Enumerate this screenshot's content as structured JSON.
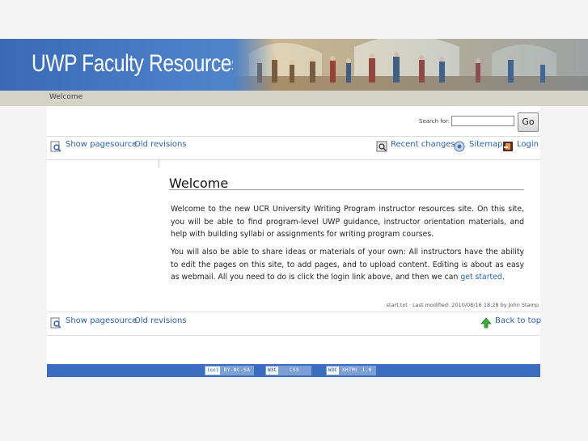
{
  "banner": {
    "title": "UWP Faculty Resources"
  },
  "breadcrumb": {
    "current": "Welcome"
  },
  "search": {
    "label": "Search for:",
    "placeholder": "",
    "button": "Go"
  },
  "toolbar_top": {
    "show_source": "Show pagesource",
    "old_revisions": "Old revisions",
    "recent_changes": "Recent changes",
    "sitemap": "Sitemap",
    "login": "Login"
  },
  "content": {
    "title": "Welcome",
    "para1": "Welcome to the new UCR University Writing Program instructor resources site. On this site, you will be able to find program-level UWP guidance, instructor orientation materials, and help with building syllabi or assignments for writing program courses.",
    "para2_before": "You will also be able to share ideas or materials of your own: All instructors have the ability to edit the pages on this site, to add pages, and to upload content. Editing is about as easy as webmail. All you need to do is click the login link above, and then we can ",
    "para2_link": "get started",
    "para2_after": "."
  },
  "modified": "start.txt · Last modified: 2010/08/16 18:28 by John Stamp",
  "toolbar_bottom": {
    "show_source": "Show pagesource",
    "old_revisions": "Old revisions",
    "back_to_top": "Back to top"
  },
  "footer_badges": [
    {
      "left": "(cc)",
      "right": "BY-NC-SA"
    },
    {
      "left": "W3C",
      "right": "CSS"
    },
    {
      "left": "W3C",
      "right": "XHTML 1.0"
    }
  ],
  "colors": {
    "banner": "#3a69b5",
    "link": "#2b63b0",
    "footer": "#3b6cc0",
    "crumbbar": "#d5d2c8"
  }
}
